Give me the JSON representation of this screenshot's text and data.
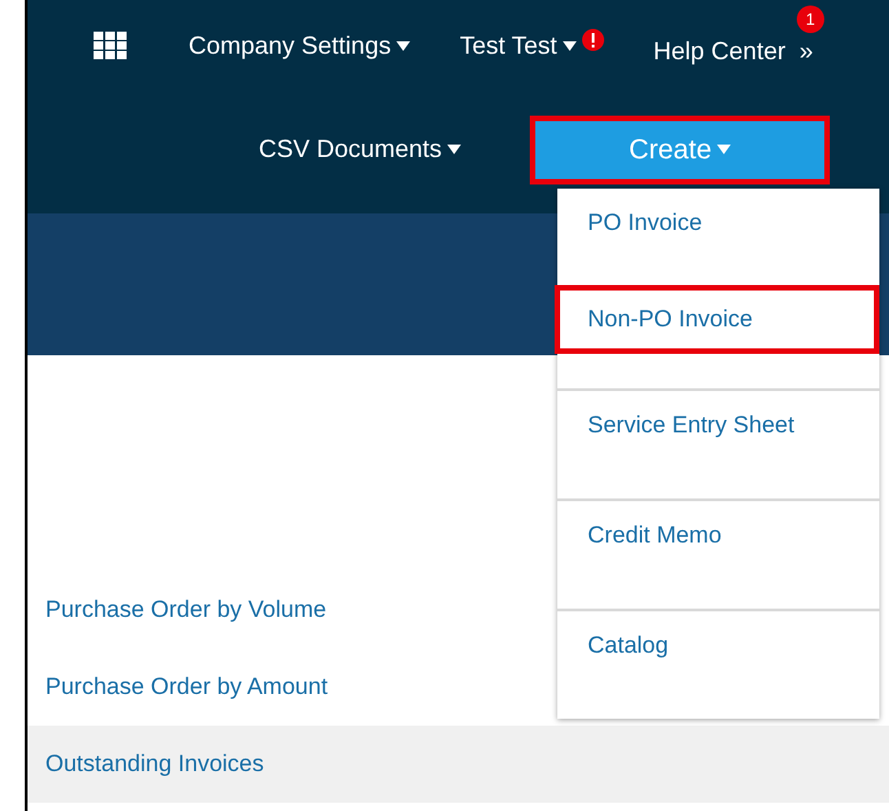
{
  "top_nav": [
    {
      "label": "Company Settings",
      "alert": false
    },
    {
      "label": "Test Test",
      "alert": true
    }
  ],
  "help": {
    "label": "Help Center",
    "chevron": "»",
    "badge": "1"
  },
  "second_nav": [
    {
      "label": "CSV Documents",
      "kind": "link",
      "highlighted": false
    },
    {
      "label": "Create",
      "kind": "button",
      "highlighted": true
    }
  ],
  "create_menu": [
    {
      "label": "PO Invoice",
      "highlighted": false
    },
    {
      "label": "Non-PO Invoice",
      "highlighted": true
    },
    {
      "label": "Service Entry Sheet",
      "highlighted": false
    },
    {
      "label": "Credit Memo",
      "highlighted": false
    },
    {
      "label": "Catalog",
      "highlighted": false
    }
  ],
  "reports": [
    {
      "label": "Purchase Order by Volume",
      "selected": false
    },
    {
      "label": "Purchase Order by Amount",
      "selected": false
    },
    {
      "label": "Outstanding Invoices",
      "selected": true
    }
  ]
}
